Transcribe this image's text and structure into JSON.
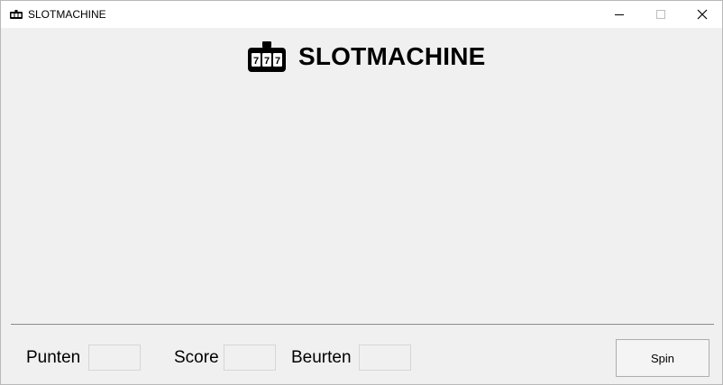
{
  "window": {
    "title": "SLOTMACHINE",
    "controls": {
      "minimize_icon": "minimize-icon",
      "maximize_icon": "maximize-icon",
      "close_icon": "close-icon"
    }
  },
  "header": {
    "logo_icon": "slot-machine-777-icon",
    "title": "SLOTMACHINE",
    "logo_digits": "777"
  },
  "footer": {
    "fields": [
      {
        "label": "Punten",
        "value": ""
      },
      {
        "label": "Score",
        "value": ""
      },
      {
        "label": "Beurten",
        "value": ""
      }
    ],
    "spin_label": "Spin"
  },
  "colors": {
    "window_bg": "#f0f0f0",
    "titlebar_bg": "#ffffff",
    "text": "#000000"
  }
}
